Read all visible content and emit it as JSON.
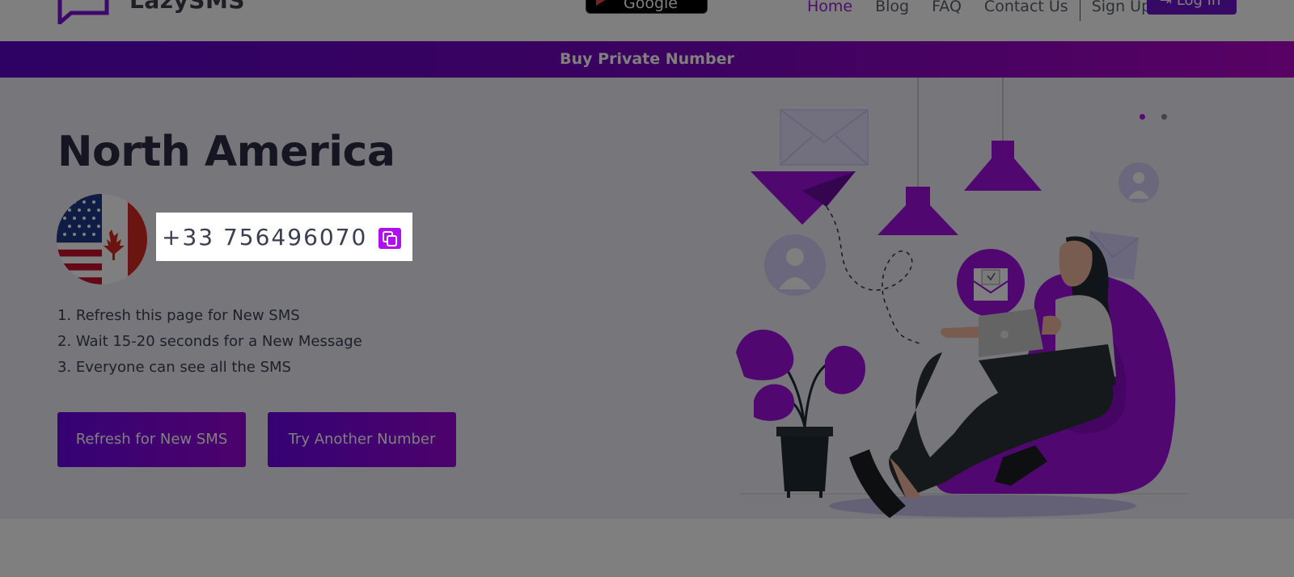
{
  "header": {
    "logo_text": "LazySMS",
    "app_store_label": "Google Play",
    "nav": [
      {
        "label": "Home",
        "active": true
      },
      {
        "label": "Blog",
        "active": false
      },
      {
        "label": "FAQ",
        "active": false
      },
      {
        "label": "Contact Us",
        "active": false
      }
    ],
    "signup_label": "Sign Up",
    "login_label": "Log In",
    "login_icon": "login-arrow-icon"
  },
  "banner": {
    "label": "Buy Private Number"
  },
  "hero": {
    "title": "North America",
    "flag_icon": "us-canada-flag-icon",
    "phone_number": "+33 756496070",
    "copy_icon": "copy-icon",
    "instructions": [
      "1. Refresh this page for New SMS",
      "2. Wait 15-20 seconds for a New Message",
      "3. Everyone can see all the SMS"
    ],
    "refresh_button": "Refresh for New SMS",
    "try_button": "Try Another Number",
    "carousel_dots": 2,
    "carousel_active_index": 0
  },
  "colors": {
    "accent": "#9a1ad8",
    "button_gradient_start": "#6a05e8",
    "button_gradient_end": "#9a05d8",
    "hero_background": "#ececf7"
  }
}
